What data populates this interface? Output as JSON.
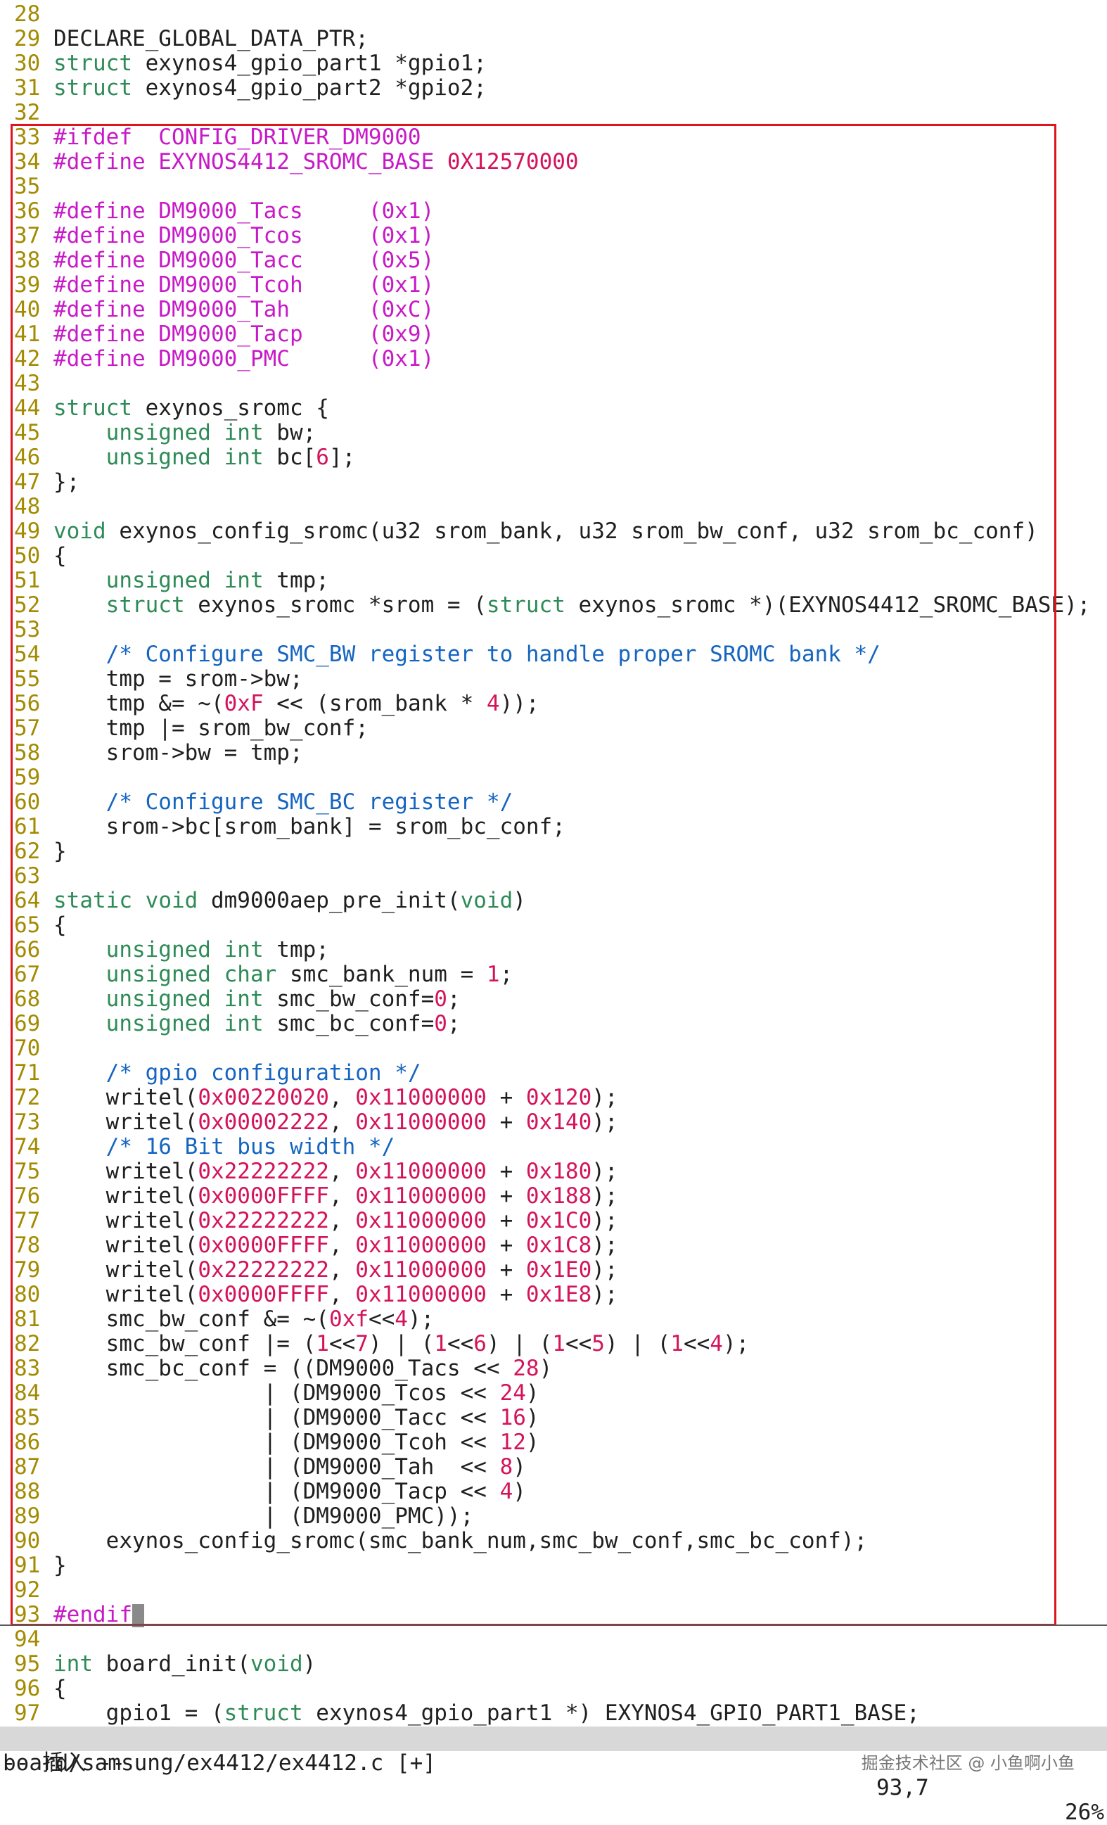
{
  "editor": {
    "lines": [
      {
        "n": "28",
        "segs": []
      },
      {
        "n": "29",
        "segs": [
          {
            "c": "tx",
            "t": "DECLARE_GLOBAL_DATA_PTR;"
          }
        ]
      },
      {
        "n": "30",
        "segs": [
          {
            "c": "k",
            "t": "struct"
          },
          {
            "c": "tx",
            "t": " exynos4_gpio_part1 *gpio1;"
          }
        ]
      },
      {
        "n": "31",
        "segs": [
          {
            "c": "k",
            "t": "struct"
          },
          {
            "c": "tx",
            "t": " exynos4_gpio_part2 *gpio2;"
          }
        ]
      },
      {
        "n": "32",
        "segs": []
      },
      {
        "n": "33",
        "segs": [
          {
            "c": "p",
            "t": "#ifdef  CONFIG_DRIVER_DM9000"
          }
        ]
      },
      {
        "n": "34",
        "segs": [
          {
            "c": "p",
            "t": "#define EXYNOS4412_SROMC_BASE "
          },
          {
            "c": "n",
            "t": "0X12570000"
          }
        ]
      },
      {
        "n": "35",
        "segs": []
      },
      {
        "n": "36",
        "segs": [
          {
            "c": "p",
            "t": "#define DM9000_Tacs     (0x1)"
          }
        ]
      },
      {
        "n": "37",
        "segs": [
          {
            "c": "p",
            "t": "#define DM9000_Tcos     (0x1)"
          }
        ]
      },
      {
        "n": "38",
        "segs": [
          {
            "c": "p",
            "t": "#define DM9000_Tacc     (0x5)"
          }
        ]
      },
      {
        "n": "39",
        "segs": [
          {
            "c": "p",
            "t": "#define DM9000_Tcoh     (0x1)"
          }
        ]
      },
      {
        "n": "40",
        "segs": [
          {
            "c": "p",
            "t": "#define DM9000_Tah      (0xC)"
          }
        ]
      },
      {
        "n": "41",
        "segs": [
          {
            "c": "p",
            "t": "#define DM9000_Tacp     (0x9)"
          }
        ]
      },
      {
        "n": "42",
        "segs": [
          {
            "c": "p",
            "t": "#define DM9000_PMC      (0x1)"
          }
        ]
      },
      {
        "n": "43",
        "segs": []
      },
      {
        "n": "44",
        "segs": [
          {
            "c": "k",
            "t": "struct"
          },
          {
            "c": "tx",
            "t": " exynos_sromc {"
          }
        ]
      },
      {
        "n": "45",
        "segs": [
          {
            "c": "tx",
            "t": "    "
          },
          {
            "c": "t",
            "t": "unsigned int"
          },
          {
            "c": "tx",
            "t": " bw;"
          }
        ]
      },
      {
        "n": "46",
        "segs": [
          {
            "c": "tx",
            "t": "    "
          },
          {
            "c": "t",
            "t": "unsigned int"
          },
          {
            "c": "tx",
            "t": " bc["
          },
          {
            "c": "n",
            "t": "6"
          },
          {
            "c": "tx",
            "t": "];"
          }
        ]
      },
      {
        "n": "47",
        "segs": [
          {
            "c": "tx",
            "t": "};"
          }
        ]
      },
      {
        "n": "48",
        "segs": []
      },
      {
        "n": "49",
        "segs": [
          {
            "c": "t",
            "t": "void"
          },
          {
            "c": "tx",
            "t": " exynos_config_sromc(u32 srom_bank, u32 srom_bw_conf, u32 srom_bc_conf)"
          }
        ]
      },
      {
        "n": "50",
        "segs": [
          {
            "c": "tx",
            "t": "{"
          }
        ]
      },
      {
        "n": "51",
        "segs": [
          {
            "c": "tx",
            "t": "    "
          },
          {
            "c": "t",
            "t": "unsigned int"
          },
          {
            "c": "tx",
            "t": " tmp;"
          }
        ]
      },
      {
        "n": "52",
        "segs": [
          {
            "c": "tx",
            "t": "    "
          },
          {
            "c": "k",
            "t": "struct"
          },
          {
            "c": "tx",
            "t": " exynos_sromc *srom = ("
          },
          {
            "c": "k",
            "t": "struct"
          },
          {
            "c": "tx",
            "t": " exynos_sromc *)(EXYNOS4412_SROMC_BASE);"
          }
        ]
      },
      {
        "n": "53",
        "segs": []
      },
      {
        "n": "54",
        "segs": [
          {
            "c": "tx",
            "t": "    "
          },
          {
            "c": "c",
            "t": "/* Configure SMC_BW register to handle proper SROMC bank */"
          }
        ]
      },
      {
        "n": "55",
        "segs": [
          {
            "c": "tx",
            "t": "    tmp = srom->bw;"
          }
        ]
      },
      {
        "n": "56",
        "segs": [
          {
            "c": "tx",
            "t": "    tmp &= ~("
          },
          {
            "c": "n",
            "t": "0xF"
          },
          {
            "c": "tx",
            "t": " << (srom_bank * "
          },
          {
            "c": "n",
            "t": "4"
          },
          {
            "c": "tx",
            "t": "));"
          }
        ]
      },
      {
        "n": "57",
        "segs": [
          {
            "c": "tx",
            "t": "    tmp |= srom_bw_conf;"
          }
        ]
      },
      {
        "n": "58",
        "segs": [
          {
            "c": "tx",
            "t": "    srom->bw = tmp;"
          }
        ]
      },
      {
        "n": "59",
        "segs": []
      },
      {
        "n": "60",
        "segs": [
          {
            "c": "tx",
            "t": "    "
          },
          {
            "c": "c",
            "t": "/* Configure SMC_BC register */"
          }
        ]
      },
      {
        "n": "61",
        "segs": [
          {
            "c": "tx",
            "t": "    srom->bc[srom_bank] = srom_bc_conf;"
          }
        ]
      },
      {
        "n": "62",
        "segs": [
          {
            "c": "tx",
            "t": "}"
          }
        ]
      },
      {
        "n": "63",
        "segs": []
      },
      {
        "n": "64",
        "segs": [
          {
            "c": "k",
            "t": "static"
          },
          {
            "c": "tx",
            "t": " "
          },
          {
            "c": "t",
            "t": "void"
          },
          {
            "c": "tx",
            "t": " dm9000aep_pre_init("
          },
          {
            "c": "t",
            "t": "void"
          },
          {
            "c": "tx",
            "t": ")"
          }
        ]
      },
      {
        "n": "65",
        "segs": [
          {
            "c": "tx",
            "t": "{"
          }
        ]
      },
      {
        "n": "66",
        "segs": [
          {
            "c": "tx",
            "t": "    "
          },
          {
            "c": "t",
            "t": "unsigned int"
          },
          {
            "c": "tx",
            "t": " tmp;"
          }
        ]
      },
      {
        "n": "67",
        "segs": [
          {
            "c": "tx",
            "t": "    "
          },
          {
            "c": "t",
            "t": "unsigned char"
          },
          {
            "c": "tx",
            "t": " smc_bank_num = "
          },
          {
            "c": "n",
            "t": "1"
          },
          {
            "c": "tx",
            "t": ";"
          }
        ]
      },
      {
        "n": "68",
        "segs": [
          {
            "c": "tx",
            "t": "    "
          },
          {
            "c": "t",
            "t": "unsigned int"
          },
          {
            "c": "tx",
            "t": " smc_bw_conf="
          },
          {
            "c": "n",
            "t": "0"
          },
          {
            "c": "tx",
            "t": ";"
          }
        ]
      },
      {
        "n": "69",
        "segs": [
          {
            "c": "tx",
            "t": "    "
          },
          {
            "c": "t",
            "t": "unsigned int"
          },
          {
            "c": "tx",
            "t": " smc_bc_conf="
          },
          {
            "c": "n",
            "t": "0"
          },
          {
            "c": "tx",
            "t": ";"
          }
        ]
      },
      {
        "n": "70",
        "segs": []
      },
      {
        "n": "71",
        "segs": [
          {
            "c": "tx",
            "t": "    "
          },
          {
            "c": "c",
            "t": "/* gpio configuration */"
          }
        ]
      },
      {
        "n": "72",
        "segs": [
          {
            "c": "tx",
            "t": "    writel("
          },
          {
            "c": "n",
            "t": "0x00220020"
          },
          {
            "c": "tx",
            "t": ", "
          },
          {
            "c": "n",
            "t": "0x11000000"
          },
          {
            "c": "tx",
            "t": " + "
          },
          {
            "c": "n",
            "t": "0x120"
          },
          {
            "c": "tx",
            "t": ");"
          }
        ]
      },
      {
        "n": "73",
        "segs": [
          {
            "c": "tx",
            "t": "    writel("
          },
          {
            "c": "n",
            "t": "0x00002222"
          },
          {
            "c": "tx",
            "t": ", "
          },
          {
            "c": "n",
            "t": "0x11000000"
          },
          {
            "c": "tx",
            "t": " + "
          },
          {
            "c": "n",
            "t": "0x140"
          },
          {
            "c": "tx",
            "t": ");"
          }
        ]
      },
      {
        "n": "74",
        "segs": [
          {
            "c": "tx",
            "t": "    "
          },
          {
            "c": "c",
            "t": "/* 16 Bit bus width */"
          }
        ]
      },
      {
        "n": "75",
        "segs": [
          {
            "c": "tx",
            "t": "    writel("
          },
          {
            "c": "n",
            "t": "0x22222222"
          },
          {
            "c": "tx",
            "t": ", "
          },
          {
            "c": "n",
            "t": "0x11000000"
          },
          {
            "c": "tx",
            "t": " + "
          },
          {
            "c": "n",
            "t": "0x180"
          },
          {
            "c": "tx",
            "t": ");"
          }
        ]
      },
      {
        "n": "76",
        "segs": [
          {
            "c": "tx",
            "t": "    writel("
          },
          {
            "c": "n",
            "t": "0x0000FFFF"
          },
          {
            "c": "tx",
            "t": ", "
          },
          {
            "c": "n",
            "t": "0x11000000"
          },
          {
            "c": "tx",
            "t": " + "
          },
          {
            "c": "n",
            "t": "0x188"
          },
          {
            "c": "tx",
            "t": ");"
          }
        ]
      },
      {
        "n": "77",
        "segs": [
          {
            "c": "tx",
            "t": "    writel("
          },
          {
            "c": "n",
            "t": "0x22222222"
          },
          {
            "c": "tx",
            "t": ", "
          },
          {
            "c": "n",
            "t": "0x11000000"
          },
          {
            "c": "tx",
            "t": " + "
          },
          {
            "c": "n",
            "t": "0x1C0"
          },
          {
            "c": "tx",
            "t": ");"
          }
        ]
      },
      {
        "n": "78",
        "segs": [
          {
            "c": "tx",
            "t": "    writel("
          },
          {
            "c": "n",
            "t": "0x0000FFFF"
          },
          {
            "c": "tx",
            "t": ", "
          },
          {
            "c": "n",
            "t": "0x11000000"
          },
          {
            "c": "tx",
            "t": " + "
          },
          {
            "c": "n",
            "t": "0x1C8"
          },
          {
            "c": "tx",
            "t": ");"
          }
        ]
      },
      {
        "n": "79",
        "segs": [
          {
            "c": "tx",
            "t": "    writel("
          },
          {
            "c": "n",
            "t": "0x22222222"
          },
          {
            "c": "tx",
            "t": ", "
          },
          {
            "c": "n",
            "t": "0x11000000"
          },
          {
            "c": "tx",
            "t": " + "
          },
          {
            "c": "n",
            "t": "0x1E0"
          },
          {
            "c": "tx",
            "t": ");"
          }
        ]
      },
      {
        "n": "80",
        "segs": [
          {
            "c": "tx",
            "t": "    writel("
          },
          {
            "c": "n",
            "t": "0x0000FFFF"
          },
          {
            "c": "tx",
            "t": ", "
          },
          {
            "c": "n",
            "t": "0x11000000"
          },
          {
            "c": "tx",
            "t": " + "
          },
          {
            "c": "n",
            "t": "0x1E8"
          },
          {
            "c": "tx",
            "t": ");"
          }
        ]
      },
      {
        "n": "81",
        "segs": [
          {
            "c": "tx",
            "t": "    smc_bw_conf &= ~("
          },
          {
            "c": "n",
            "t": "0xf"
          },
          {
            "c": "tx",
            "t": "<<"
          },
          {
            "c": "n",
            "t": "4"
          },
          {
            "c": "tx",
            "t": ");"
          }
        ]
      },
      {
        "n": "82",
        "segs": [
          {
            "c": "tx",
            "t": "    smc_bw_conf |= ("
          },
          {
            "c": "n",
            "t": "1"
          },
          {
            "c": "tx",
            "t": "<<"
          },
          {
            "c": "n",
            "t": "7"
          },
          {
            "c": "tx",
            "t": ") | ("
          },
          {
            "c": "n",
            "t": "1"
          },
          {
            "c": "tx",
            "t": "<<"
          },
          {
            "c": "n",
            "t": "6"
          },
          {
            "c": "tx",
            "t": ") | ("
          },
          {
            "c": "n",
            "t": "1"
          },
          {
            "c": "tx",
            "t": "<<"
          },
          {
            "c": "n",
            "t": "5"
          },
          {
            "c": "tx",
            "t": ") | ("
          },
          {
            "c": "n",
            "t": "1"
          },
          {
            "c": "tx",
            "t": "<<"
          },
          {
            "c": "n",
            "t": "4"
          },
          {
            "c": "tx",
            "t": ");"
          }
        ]
      },
      {
        "n": "83",
        "segs": [
          {
            "c": "tx",
            "t": "    smc_bc_conf = ((DM9000_Tacs << "
          },
          {
            "c": "n",
            "t": "28"
          },
          {
            "c": "tx",
            "t": ")"
          }
        ]
      },
      {
        "n": "84",
        "segs": [
          {
            "c": "tx",
            "t": "                | (DM9000_Tcos << "
          },
          {
            "c": "n",
            "t": "24"
          },
          {
            "c": "tx",
            "t": ")"
          }
        ]
      },
      {
        "n": "85",
        "segs": [
          {
            "c": "tx",
            "t": "                | (DM9000_Tacc << "
          },
          {
            "c": "n",
            "t": "16"
          },
          {
            "c": "tx",
            "t": ")"
          }
        ]
      },
      {
        "n": "86",
        "segs": [
          {
            "c": "tx",
            "t": "                | (DM9000_Tcoh << "
          },
          {
            "c": "n",
            "t": "12"
          },
          {
            "c": "tx",
            "t": ")"
          }
        ]
      },
      {
        "n": "87",
        "segs": [
          {
            "c": "tx",
            "t": "                | (DM9000_Tah  << "
          },
          {
            "c": "n",
            "t": "8"
          },
          {
            "c": "tx",
            "t": ")"
          }
        ]
      },
      {
        "n": "88",
        "segs": [
          {
            "c": "tx",
            "t": "                | (DM9000_Tacp << "
          },
          {
            "c": "n",
            "t": "4"
          },
          {
            "c": "tx",
            "t": ")"
          }
        ]
      },
      {
        "n": "89",
        "segs": [
          {
            "c": "tx",
            "t": "                | (DM9000_PMC));"
          }
        ]
      },
      {
        "n": "90",
        "segs": [
          {
            "c": "tx",
            "t": "    exynos_config_sromc(smc_bank_num,smc_bw_conf,smc_bc_conf);"
          }
        ]
      },
      {
        "n": "91",
        "segs": [
          {
            "c": "tx",
            "t": "}"
          }
        ]
      },
      {
        "n": "92",
        "segs": []
      },
      {
        "n": "93",
        "segs": [
          {
            "c": "p",
            "t": "#endif"
          }
        ],
        "cursor": true
      },
      {
        "n": "94",
        "segs": []
      },
      {
        "n": "95",
        "segs": [
          {
            "c": "t",
            "t": "int"
          },
          {
            "c": "tx",
            "t": " board_init("
          },
          {
            "c": "t",
            "t": "void"
          },
          {
            "c": "tx",
            "t": ")"
          }
        ]
      },
      {
        "n": "96",
        "segs": [
          {
            "c": "tx",
            "t": "{"
          }
        ]
      },
      {
        "n": "97",
        "segs": [
          {
            "c": "tx",
            "t": "    gpio1 = ("
          },
          {
            "c": "k",
            "t": "struct"
          },
          {
            "c": "tx",
            "t": " exynos4_gpio_part1 *) EXYNOS4_GPIO_PART1_BASE;"
          }
        ]
      }
    ]
  },
  "statusbar": {
    "file": "board/samsung/ex4412/ex4412.c [+]",
    "position": "93,7",
    "percent": "26%"
  },
  "modeline": {
    "text": "-- 插入 --"
  },
  "watermark": {
    "text": "掘金技术社区 @ 小鱼啊小鱼"
  },
  "colors": {
    "highlight_box": "#e0141c",
    "keyword": "#2e8b57",
    "preprocessor": "#c71ac7",
    "number": "#d4145a",
    "comment": "#1565c0",
    "line_number": "#a38a00"
  }
}
